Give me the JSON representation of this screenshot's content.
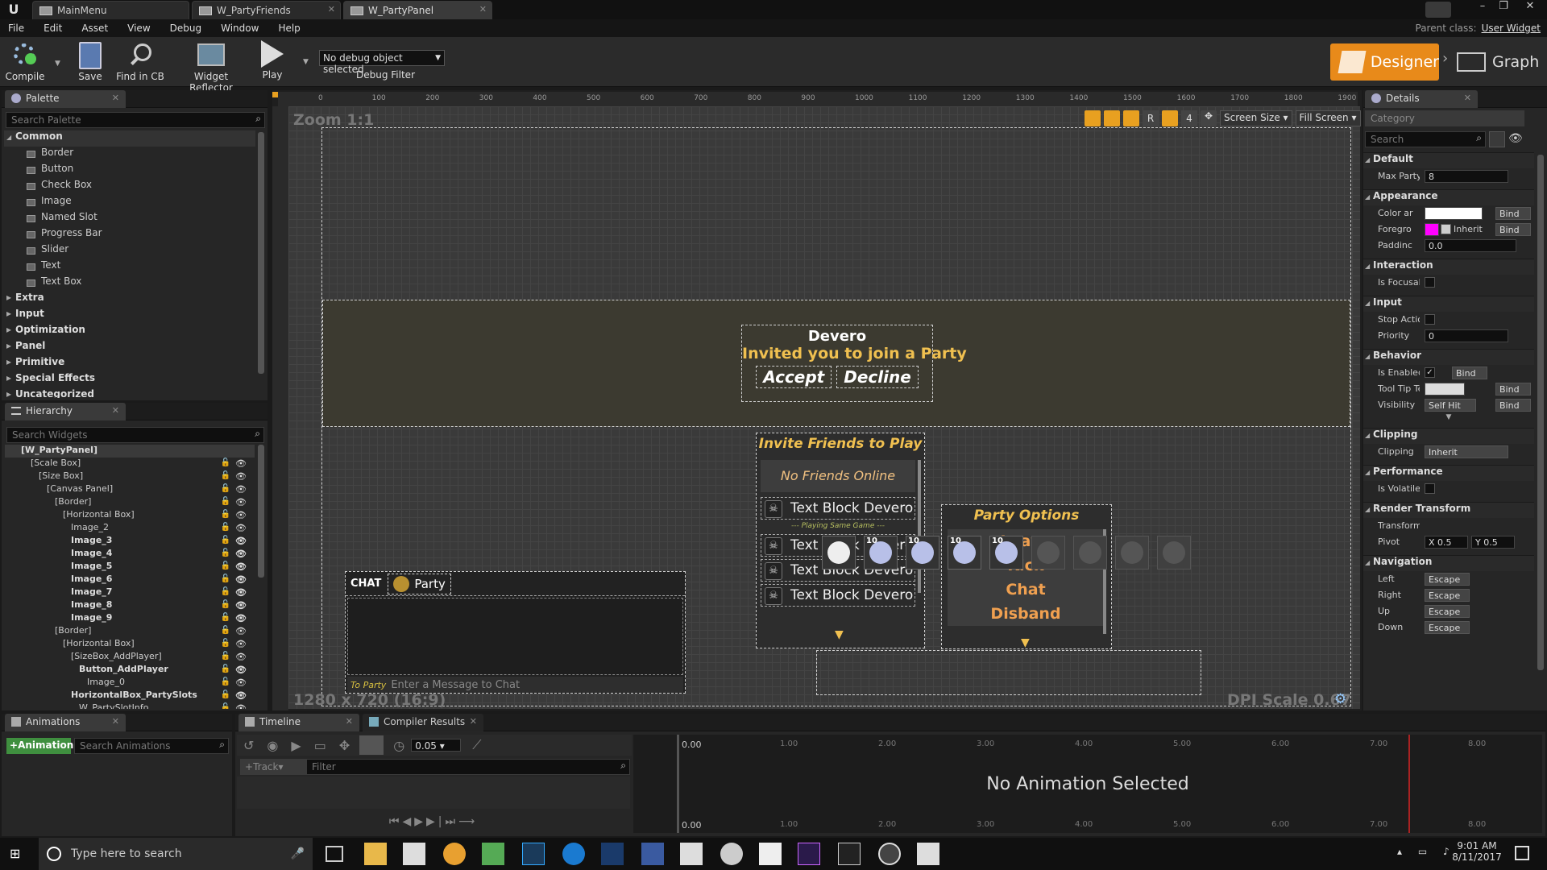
{
  "titlebar": {
    "tabs": [
      {
        "label": "MainMenu"
      },
      {
        "label": "W_PartyFriends"
      },
      {
        "label": "W_PartyPanel"
      }
    ],
    "parent_class_label": "Parent class:",
    "parent_class_value": "User Widget"
  },
  "menubar": [
    "File",
    "Edit",
    "Asset",
    "View",
    "Debug",
    "Window",
    "Help"
  ],
  "toolbar": {
    "compile": "Compile",
    "save": "Save",
    "find": "Find in CB",
    "reflector": "Widget Reflector",
    "play": "Play",
    "debug_select": "No debug object selected",
    "debug_filter": "Debug Filter",
    "designer": "Designer",
    "graph": "Graph"
  },
  "palette": {
    "tab": "Palette",
    "search_placeholder": "Search Palette",
    "category_common": "Common",
    "common_items": [
      "Border",
      "Button",
      "Check Box",
      "Image",
      "Named Slot",
      "Progress Bar",
      "Slider",
      "Text",
      "Text Box"
    ],
    "categories": [
      "Extra",
      "Input",
      "Optimization",
      "Panel",
      "Primitive",
      "Special Effects",
      "Uncategorized"
    ]
  },
  "hierarchy": {
    "tab": "Hierarchy",
    "search_placeholder": "Search Widgets",
    "items": [
      {
        "label": "[W_PartyPanel]",
        "bold": true
      },
      {
        "label": "[Scale Box]"
      },
      {
        "label": "[Size Box]"
      },
      {
        "label": "[Canvas Panel]"
      },
      {
        "label": "[Border]"
      },
      {
        "label": "[Horizontal Box]"
      },
      {
        "label": "Image_2"
      },
      {
        "label": "Image_3",
        "bold": true
      },
      {
        "label": "Image_4",
        "bold": true
      },
      {
        "label": "Image_5",
        "bold": true
      },
      {
        "label": "Image_6",
        "bold": true
      },
      {
        "label": "Image_7",
        "bold": true
      },
      {
        "label": "Image_8",
        "bold": true
      },
      {
        "label": "Image_9",
        "bold": true
      },
      {
        "label": "[Border]"
      },
      {
        "label": "[Horizontal Box]"
      },
      {
        "label": "[SizeBox_AddPlayer]"
      },
      {
        "label": "Button_AddPlayer",
        "bold": true
      },
      {
        "label": "Image_0"
      },
      {
        "label": "HorizontalBox_PartySlots",
        "bold": true
      },
      {
        "label": "W_PartySlotInfo"
      }
    ]
  },
  "designer": {
    "zoom": "Zoom 1:1",
    "ruler": [
      "0",
      "100",
      "200",
      "300",
      "400",
      "500",
      "600",
      "700",
      "800",
      "900",
      "1000",
      "1100",
      "1200",
      "1300",
      "1400",
      "1500",
      "1600",
      "1700",
      "1800",
      "1900"
    ],
    "screen_size": "Screen Size",
    "fill_screen": "Fill Screen",
    "toolbar_r": "R",
    "toolbar_4": "4",
    "resolution": "1280 x 720 (16:9)",
    "dpi": "DPI Scale 0.67",
    "invite": {
      "name": "Devero",
      "message": "Invited you to join a Party",
      "accept": "Accept",
      "decline": "Decline"
    },
    "friends": {
      "title": "Invite Friends to Play",
      "no_online": "No Friends Online",
      "items": [
        "Text Block Devero",
        "Text Block Devero",
        "Text Block Devero",
        "Text Block Devero"
      ],
      "separator": "--- Playing Same Game ---"
    },
    "party_options": {
      "title": "Party Options",
      "items": [
        "Leave",
        "Kick",
        "Chat",
        "Disband"
      ]
    },
    "chat": {
      "label": "CHAT",
      "channel": "Party",
      "to": "To Party",
      "placeholder": "Enter a Message to Chat"
    },
    "slots": [
      {
        "level": "",
        "filled": true,
        "add": true
      },
      {
        "level": "10",
        "filled": true
      },
      {
        "level": "10",
        "filled": true
      },
      {
        "level": "10",
        "filled": true
      },
      {
        "level": "10",
        "filled": true
      },
      {
        "level": "",
        "filled": false
      },
      {
        "level": "",
        "filled": false
      },
      {
        "level": "",
        "filled": false
      },
      {
        "level": "",
        "filled": false
      }
    ]
  },
  "details": {
    "tab": "Details",
    "category_placeholder": "Category",
    "search_placeholder": "Search",
    "sections": {
      "default": "Default",
      "appearance": "Appearance",
      "interaction": "Interaction",
      "input": "Input",
      "behavior": "Behavior",
      "clipping": "Clipping",
      "performance": "Performance",
      "render": "Render Transform",
      "navigation": "Navigation"
    },
    "max_party_label": "Max Party",
    "max_party_value": "8",
    "color_label": "Color ar",
    "foreground_label": "Foregro",
    "foreground_color": "#ff00ff",
    "inherit_label": "Inherit",
    "padding_label": "Paddinc",
    "padding_value": "0.0",
    "focusable_label": "Is Focusabl",
    "stop_action_label": "Stop Action",
    "priority_label": "Priority",
    "priority_value": "0",
    "enabled_label": "Is Enabled",
    "tooltip_label": "Tool Tip Te",
    "visibility_label": "Visibility",
    "visibility_value": "Self Hit",
    "bind": "Bind",
    "clipping_label": "Clipping",
    "clipping_value": "Inherit",
    "volatile_label": "Is Volatile",
    "transform_label": "Transform",
    "pivot_label": "Pivot",
    "pivot_x": "X 0.5",
    "pivot_y": "Y 0.5",
    "nav": [
      {
        "label": "Left",
        "value": "Escape"
      },
      {
        "label": "Right",
        "value": "Escape"
      },
      {
        "label": "Up",
        "value": "Escape"
      },
      {
        "label": "Down",
        "value": "Escape"
      }
    ]
  },
  "animations": {
    "tab": "Animations",
    "add": "Animation",
    "search_placeholder": "Search Animations"
  },
  "timeline": {
    "tab": "Timeline",
    "compiler_tab": "Compiler Results",
    "speed": "0.05",
    "track": "Track",
    "filter_placeholder": "Filter",
    "no_anim": "No Animation Selected",
    "time_start": "0.00",
    "ticks": [
      "1.00",
      "2.00",
      "3.00",
      "4.00",
      "5.00",
      "6.00",
      "7.00",
      "8.00"
    ]
  },
  "taskbar": {
    "search": "Type here to search",
    "time": "9:01 AM",
    "date": "8/11/2017"
  }
}
